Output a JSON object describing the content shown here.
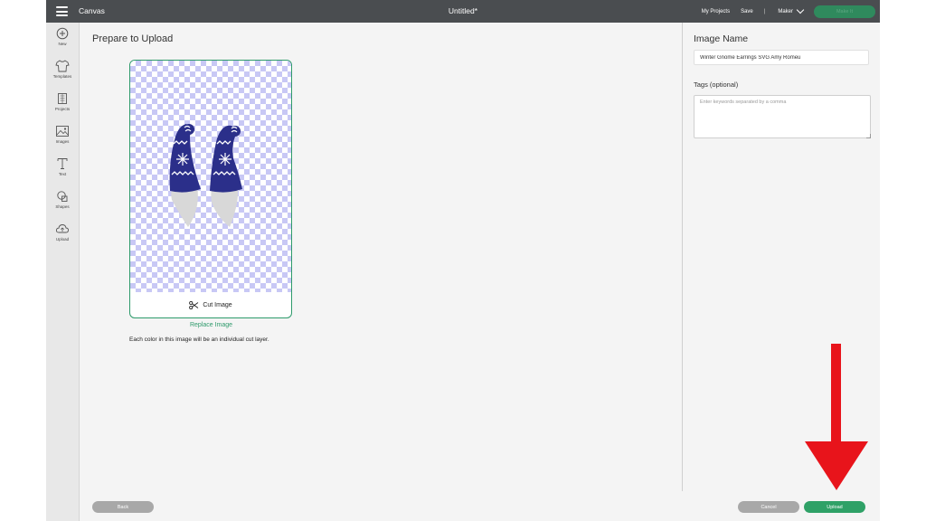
{
  "topbar": {
    "app_name": "Canvas",
    "doc_title": "Untitled*",
    "my_projects": "My Projects",
    "save": "Save",
    "separator": "|",
    "machine": "Maker",
    "make_it": "Make It"
  },
  "sidebar": {
    "items": [
      {
        "label": "New",
        "icon": "plus-circle-icon"
      },
      {
        "label": "Templates",
        "icon": "shirt-icon"
      },
      {
        "label": "Projects",
        "icon": "projects-icon"
      },
      {
        "label": "Images",
        "icon": "image-icon"
      },
      {
        "label": "Text",
        "icon": "text-icon"
      },
      {
        "label": "Shapes",
        "icon": "shapes-icon"
      },
      {
        "label": "Upload",
        "icon": "cloud-upload-icon"
      }
    ]
  },
  "main": {
    "title": "Prepare to Upload",
    "cut_image_label": "Cut Image",
    "replace_image": "Replace Image",
    "note": "Each color in this image will be an individual cut layer."
  },
  "right_panel": {
    "image_name_heading": "Image Name",
    "image_name_value": "Winter Gnome Earrings SVG Amy Romeu",
    "tags_label": "Tags (optional)",
    "tags_placeholder": "Enter keywords separated by a comma"
  },
  "footer": {
    "back": "Back",
    "cancel": "Cancel",
    "upload": "Upload"
  },
  "colors": {
    "accent_green": "#2fa167",
    "gnome_hat": "#2b2f8a",
    "beard": "#d8d8d8",
    "arrow_red": "#e8141b"
  }
}
